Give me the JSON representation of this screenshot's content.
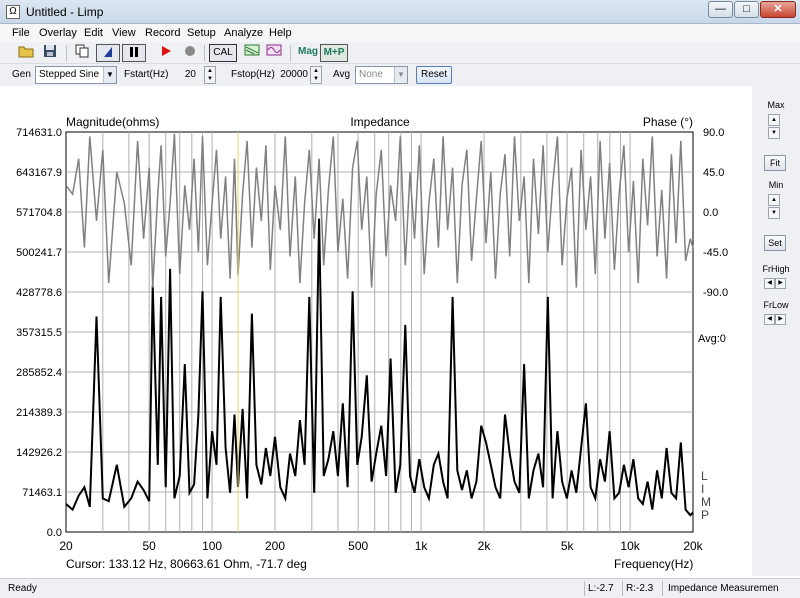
{
  "window": {
    "title": "Untitled - Limp",
    "icon": "ohm-icon",
    "icon_glyph": "Ω"
  },
  "window_controls": {
    "minimize": "—",
    "maximize": "□",
    "close": "✕"
  },
  "menu": [
    "File",
    "Overlay",
    "Edit",
    "View",
    "Record",
    "Setup",
    "Analyze",
    "Help"
  ],
  "toolbar": {
    "cal_label": "CAL",
    "mag_label": "Mag",
    "mp_label": "M+P",
    "icons": [
      "open-folder-icon",
      "save-disk-icon",
      "copy-icon",
      "cursor-mode-icon",
      "pause-icon",
      "record-icon",
      "stop-icon",
      "cal-icon",
      "filter-icon",
      "waveform-icon"
    ]
  },
  "generator": {
    "gen_label": "Gen",
    "gen_value": "Stepped Sine",
    "fstart_label": "Fstart(Hz)",
    "fstart_value": "20",
    "fstop_label": "Fstop(Hz)",
    "fstop_value": "20000",
    "avg_label": "Avg",
    "avg_value": "None",
    "reset_label": "Reset"
  },
  "side_panel": {
    "max_label": "Max",
    "fit_label": "Fit",
    "min_label": "Min",
    "set_label": "Set",
    "frhigh_label": "FrHigh",
    "frlow_label": "FrLow"
  },
  "status": {
    "ready": "Ready",
    "left": "L:-2.7",
    "right": "R:-2.3",
    "mode": "Impedance Measuremen"
  },
  "colors": {
    "magnitude": "#000000",
    "phase": "#808080",
    "cursor": "#e8d86a",
    "grid": "#b0b0b0"
  },
  "chart_data": {
    "type": "line",
    "title": "Impedance",
    "ylabel_left": "Magnitude(ohms)",
    "ylabel_right": "Phase (°)",
    "xlabel": "Frequency(Hz)",
    "x_scale": "log",
    "xlim": [
      20,
      20000
    ],
    "ylim_left": [
      0,
      714631.0
    ],
    "ylim_right": [
      -90,
      90
    ],
    "left_ticks": [
      "714631.0",
      "643167.9",
      "571704.8",
      "500241.7",
      "428778.6",
      "357315.5",
      "285852.4",
      "214389.3",
      "142926.2",
      "71463.1",
      "0.0"
    ],
    "right_ticks": [
      "90.0",
      "45.0",
      "0.0",
      "-45.0",
      "-90.0"
    ],
    "x_ticks": [
      {
        "label": "20",
        "value": 20
      },
      {
        "label": "50",
        "value": 50
      },
      {
        "label": "100",
        "value": 100
      },
      {
        "label": "200",
        "value": 200
      },
      {
        "label": "500",
        "value": 500
      },
      {
        "label": "1k",
        "value": 1000
      },
      {
        "label": "2k",
        "value": 2000
      },
      {
        "label": "5k",
        "value": 5000
      },
      {
        "label": "10k",
        "value": 10000
      },
      {
        "label": "20k",
        "value": 20000
      }
    ],
    "avg_text": "Avg:0",
    "limp_text": "LIMP",
    "cursor": {
      "frequency": 133.12,
      "text": "Cursor: 133.12 Hz, 80663.61 Ohm, -71.7 deg"
    },
    "grid": true,
    "series": [
      {
        "name": "Magnitude(ohms)",
        "axis": "left",
        "x": [
          20,
          21.5,
          23,
          24.5,
          26,
          28,
          30,
          32,
          35,
          38,
          41,
          44,
          47,
          50,
          52,
          55,
          57,
          60,
          63,
          66,
          70,
          74,
          78,
          82,
          86,
          90,
          95,
          100,
          105,
          110,
          116,
          122,
          128,
          133,
          140,
          147,
          155,
          163,
          172,
          181,
          190,
          200,
          212,
          224,
          236,
          250,
          263,
          277,
          292,
          308,
          325,
          342,
          360,
          380,
          400,
          422,
          445,
          470,
          495,
          520,
          550,
          580,
          610,
          645,
          680,
          715,
          755,
          795,
          840,
          885,
          930,
          980,
          1035,
          1090,
          1150,
          1210,
          1275,
          1340,
          1415,
          1490,
          1570,
          1655,
          1745,
          1840,
          1940,
          2045,
          2155,
          2270,
          2390,
          2520,
          2655,
          2800,
          2950,
          3110,
          3275,
          3450,
          3640,
          3835,
          4040,
          4260,
          4490,
          4730,
          4985,
          5250,
          5530,
          5830,
          6145,
          6475,
          6820,
          7190,
          7575,
          7980,
          8410,
          8860,
          9340,
          9840,
          10370,
          10930,
          11510,
          12130,
          12780,
          13470,
          14190,
          14950,
          15760,
          16600,
          17490,
          18430,
          19420,
          20000
        ],
        "values": [
          50000,
          40000,
          65000,
          80000,
          45000,
          385000,
          60000,
          55000,
          120000,
          45000,
          60000,
          90000,
          75000,
          55000,
          440000,
          120000,
          420000,
          80000,
          470000,
          60000,
          100000,
          300000,
          70000,
          85000,
          210000,
          430000,
          60000,
          180000,
          120000,
          420000,
          150000,
          70000,
          210000,
          80660,
          220000,
          60000,
          390000,
          120000,
          85000,
          150000,
          100000,
          170000,
          80000,
          60000,
          140000,
          100000,
          200000,
          120000,
          420000,
          70000,
          560000,
          100000,
          130000,
          180000,
          100000,
          230000,
          80000,
          430000,
          120000,
          170000,
          280000,
          90000,
          140000,
          190000,
          100000,
          310000,
          70000,
          120000,
          370000,
          100000,
          70000,
          130000,
          80000,
          60000,
          120000,
          140000,
          90000,
          60000,
          420000,
          110000,
          75000,
          110000,
          60000,
          90000,
          190000,
          160000,
          120000,
          80000,
          60000,
          210000,
          140000,
          90000,
          70000,
          300000,
          60000,
          110000,
          140000,
          80000,
          420000,
          60000,
          180000,
          90000,
          60000,
          110000,
          70000,
          150000,
          230000,
          80000,
          60000,
          130000,
          90000,
          180000,
          60000,
          70000,
          120000,
          80000,
          130000,
          60000,
          50000,
          90000,
          40000,
          110000,
          60000,
          150000,
          70000,
          60000,
          160000,
          40000,
          30000,
          35000
        ]
      },
      {
        "name": "Phase (°)",
        "axis": "right",
        "x": [
          20,
          21.5,
          23,
          24.5,
          26,
          28,
          30,
          32,
          35,
          38,
          41,
          44,
          47,
          50,
          52,
          55,
          57,
          60,
          63,
          66,
          70,
          74,
          78,
          82,
          86,
          90,
          95,
          100,
          105,
          110,
          116,
          122,
          128,
          133,
          140,
          147,
          155,
          163,
          172,
          181,
          190,
          200,
          212,
          224,
          236,
          250,
          263,
          277,
          292,
          308,
          325,
          342,
          360,
          380,
          400,
          422,
          445,
          470,
          495,
          520,
          550,
          580,
          610,
          645,
          680,
          715,
          755,
          795,
          840,
          885,
          930,
          980,
          1035,
          1090,
          1150,
          1210,
          1275,
          1340,
          1415,
          1490,
          1570,
          1655,
          1745,
          1840,
          1940,
          2045,
          2155,
          2270,
          2390,
          2520,
          2655,
          2800,
          2950,
          3110,
          3275,
          3450,
          3640,
          3835,
          4040,
          4260,
          4490,
          4730,
          4985,
          5250,
          5530,
          5830,
          6145,
          6475,
          6820,
          7190,
          7575,
          7980,
          8410,
          8860,
          9340,
          9840,
          10370,
          10930,
          11510,
          12130,
          12780,
          13470,
          14190,
          14950,
          15760,
          16600,
          17490,
          18430,
          19420,
          20000
        ],
        "values": [
          30,
          20,
          60,
          -40,
          85,
          -10,
          70,
          -80,
          45,
          10,
          -60,
          80,
          -30,
          50,
          -85,
          20,
          75,
          -50,
          10,
          88,
          -70,
          30,
          -20,
          60,
          -45,
          85,
          -60,
          10,
          70,
          -30,
          40,
          -75,
          60,
          -71.7,
          20,
          80,
          -40,
          50,
          -10,
          75,
          -65,
          30,
          -20,
          85,
          -50,
          40,
          -80,
          10,
          70,
          -30,
          60,
          -60,
          25,
          85,
          -45,
          15,
          -75,
          50,
          80,
          -20,
          40,
          -85,
          20,
          70,
          -50,
          30,
          -10,
          85,
          -60,
          45,
          -30,
          75,
          -70,
          10,
          60,
          -40,
          85,
          -20,
          50,
          -80,
          30,
          70,
          -55,
          15,
          80,
          -35,
          45,
          -75,
          20,
          65,
          -50,
          85,
          -10,
          40,
          -80,
          60,
          -25,
          75,
          -45,
          30,
          85,
          -60,
          15,
          50,
          -85,
          70,
          -20,
          40,
          -70,
          80,
          -30,
          55,
          -65,
          20,
          75,
          -45,
          35,
          -80,
          60,
          -15,
          85,
          -50,
          25,
          -75,
          65,
          -35,
          80,
          -55,
          -30,
          -40
        ]
      }
    ]
  }
}
